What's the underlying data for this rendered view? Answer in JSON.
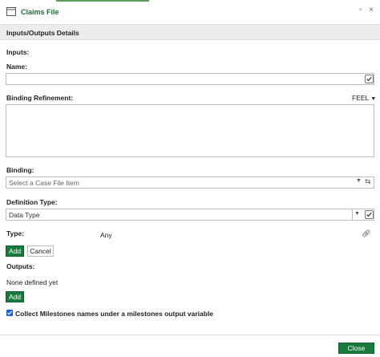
{
  "window": {
    "title": "Claims File",
    "icon": "folder-icon"
  },
  "section": {
    "title": "Inputs/Outputs Details"
  },
  "inputs": {
    "heading": "Inputs:",
    "name_label": "Name:",
    "name_value": "",
    "binding_refinement_label": "Binding Refinement:",
    "feel_label": "FEEL",
    "binding_refinement_value": "",
    "binding_label": "Binding:",
    "binding_placeholder": "Select a Case File Item",
    "definition_type_label": "Definition Type:",
    "definition_type_value": "Data Type",
    "type_label": "Type:",
    "type_value": "Any",
    "add_label": "Add",
    "cancel_label": "Cancel"
  },
  "outputs": {
    "heading": "Outputs:",
    "empty_text": "None defined yet",
    "add_label": "Add"
  },
  "milestones": {
    "checkbox_label": "Collect Milestones names under a milestones output variable",
    "checked": true
  },
  "footer": {
    "close_label": "Close"
  },
  "colors": {
    "accent_green": "#197a3e",
    "title_green": "#1e6b3a",
    "section_bg": "#ececec"
  }
}
